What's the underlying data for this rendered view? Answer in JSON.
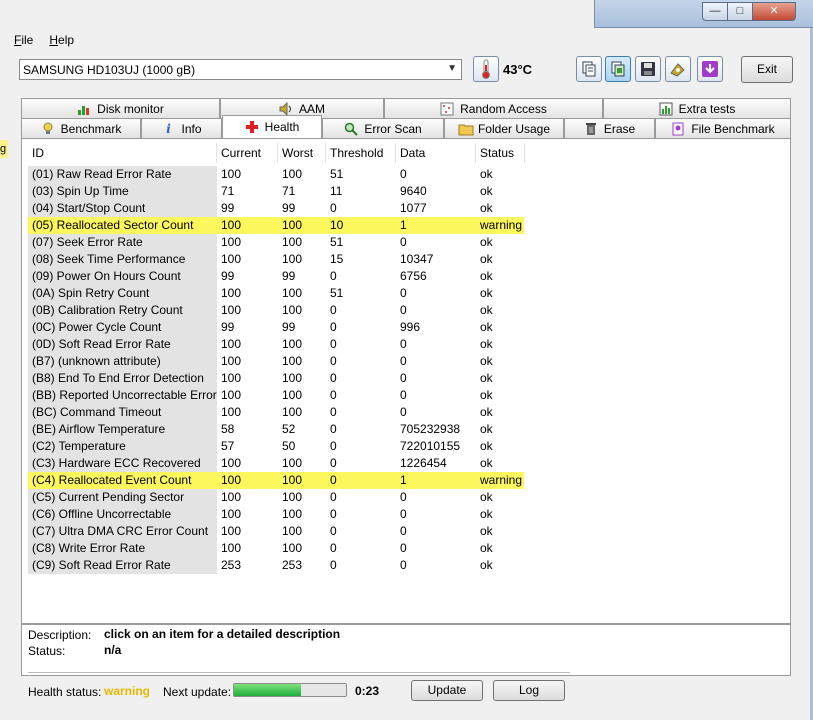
{
  "window": {
    "minimize_glyph": "—",
    "maximize_glyph": "□",
    "close_glyph": "✕"
  },
  "menu": [
    {
      "label": "File",
      "mnemonic": "F",
      "rest": "ile"
    },
    {
      "label": "Help",
      "mnemonic": "H",
      "rest": "elp"
    }
  ],
  "toolbar": {
    "drive": "SAMSUNG HD103UJ (1000 gB)",
    "temperature": "43°C",
    "exit_label": "Exit",
    "icons": [
      "copy-icon",
      "copy-screenshot-icon",
      "save-icon",
      "options-icon",
      "download-icon"
    ]
  },
  "tabs_row1": [
    "Disk monitor",
    "AAM",
    "Random Access",
    "Extra tests"
  ],
  "tabs_row2": [
    "Benchmark",
    "Info",
    "Health",
    "Error Scan",
    "Folder Usage",
    "Erase",
    "File Benchmark"
  ],
  "selected_tab": "Health",
  "side_marker": "g",
  "table": {
    "columns": [
      "ID",
      "Current",
      "Worst",
      "Threshold",
      "Data",
      "Status"
    ],
    "rows": [
      {
        "id": "(01) Raw Read Error Rate",
        "current": "100",
        "worst": "100",
        "threshold": "51",
        "data": "0",
        "status": "ok"
      },
      {
        "id": "(03) Spin Up Time",
        "current": "71",
        "worst": "71",
        "threshold": "11",
        "data": "9640",
        "status": "ok"
      },
      {
        "id": "(04) Start/Stop Count",
        "current": "99",
        "worst": "99",
        "threshold": "0",
        "data": "1077",
        "status": "ok"
      },
      {
        "id": "(05) Reallocated Sector Count",
        "current": "100",
        "worst": "100",
        "threshold": "10",
        "data": "1",
        "status": "warning"
      },
      {
        "id": "(07) Seek Error Rate",
        "current": "100",
        "worst": "100",
        "threshold": "51",
        "data": "0",
        "status": "ok"
      },
      {
        "id": "(08) Seek Time Performance",
        "current": "100",
        "worst": "100",
        "threshold": "15",
        "data": "10347",
        "status": "ok"
      },
      {
        "id": "(09) Power On Hours Count",
        "current": "99",
        "worst": "99",
        "threshold": "0",
        "data": "6756",
        "status": "ok"
      },
      {
        "id": "(0A) Spin Retry Count",
        "current": "100",
        "worst": "100",
        "threshold": "51",
        "data": "0",
        "status": "ok"
      },
      {
        "id": "(0B) Calibration Retry Count",
        "current": "100",
        "worst": "100",
        "threshold": "0",
        "data": "0",
        "status": "ok"
      },
      {
        "id": "(0C) Power Cycle Count",
        "current": "99",
        "worst": "99",
        "threshold": "0",
        "data": "996",
        "status": "ok"
      },
      {
        "id": "(0D) Soft Read Error Rate",
        "current": "100",
        "worst": "100",
        "threshold": "0",
        "data": "0",
        "status": "ok"
      },
      {
        "id": "(B7) (unknown attribute)",
        "current": "100",
        "worst": "100",
        "threshold": "0",
        "data": "0",
        "status": "ok"
      },
      {
        "id": "(B8) End To End Error Detection",
        "current": "100",
        "worst": "100",
        "threshold": "0",
        "data": "0",
        "status": "ok"
      },
      {
        "id": "(BB) Reported Uncorrectable Errors",
        "current": "100",
        "worst": "100",
        "threshold": "0",
        "data": "0",
        "status": "ok"
      },
      {
        "id": "(BC) Command Timeout",
        "current": "100",
        "worst": "100",
        "threshold": "0",
        "data": "0",
        "status": "ok"
      },
      {
        "id": "(BE) Airflow Temperature",
        "current": "58",
        "worst": "52",
        "threshold": "0",
        "data": "705232938",
        "status": "ok"
      },
      {
        "id": "(C2) Temperature",
        "current": "57",
        "worst": "50",
        "threshold": "0",
        "data": "722010155",
        "status": "ok"
      },
      {
        "id": "(C3) Hardware ECC Recovered",
        "current": "100",
        "worst": "100",
        "threshold": "0",
        "data": "1226454",
        "status": "ok"
      },
      {
        "id": "(C4) Reallocated Event Count",
        "current": "100",
        "worst": "100",
        "threshold": "0",
        "data": "1",
        "status": "warning"
      },
      {
        "id": "(C5) Current Pending Sector",
        "current": "100",
        "worst": "100",
        "threshold": "0",
        "data": "0",
        "status": "ok"
      },
      {
        "id": "(C6) Offline Uncorrectable",
        "current": "100",
        "worst": "100",
        "threshold": "0",
        "data": "0",
        "status": "ok"
      },
      {
        "id": "(C7) Ultra DMA CRC Error Count",
        "current": "100",
        "worst": "100",
        "threshold": "0",
        "data": "0",
        "status": "ok"
      },
      {
        "id": "(C8) Write Error Rate",
        "current": "100",
        "worst": "100",
        "threshold": "0",
        "data": "0",
        "status": "ok"
      },
      {
        "id": "(C9) Soft Read Error Rate",
        "current": "253",
        "worst": "253",
        "threshold": "0",
        "data": "0",
        "status": "ok"
      }
    ]
  },
  "description": {
    "label": "Description:",
    "value": "click on an item for a detailed description",
    "status_label": "Status:",
    "status_value": "n/a"
  },
  "footer": {
    "health_label": "Health status:",
    "health_value": "warning",
    "next_update_label": "Next update:",
    "progress_fraction": 0.6,
    "countdown": "0:23",
    "update_label": "Update",
    "log_label": "Log"
  },
  "colors": {
    "warning_row": "#fbf75c",
    "warning_text": "#e8b800",
    "progress_fill": "#1fae3a"
  }
}
